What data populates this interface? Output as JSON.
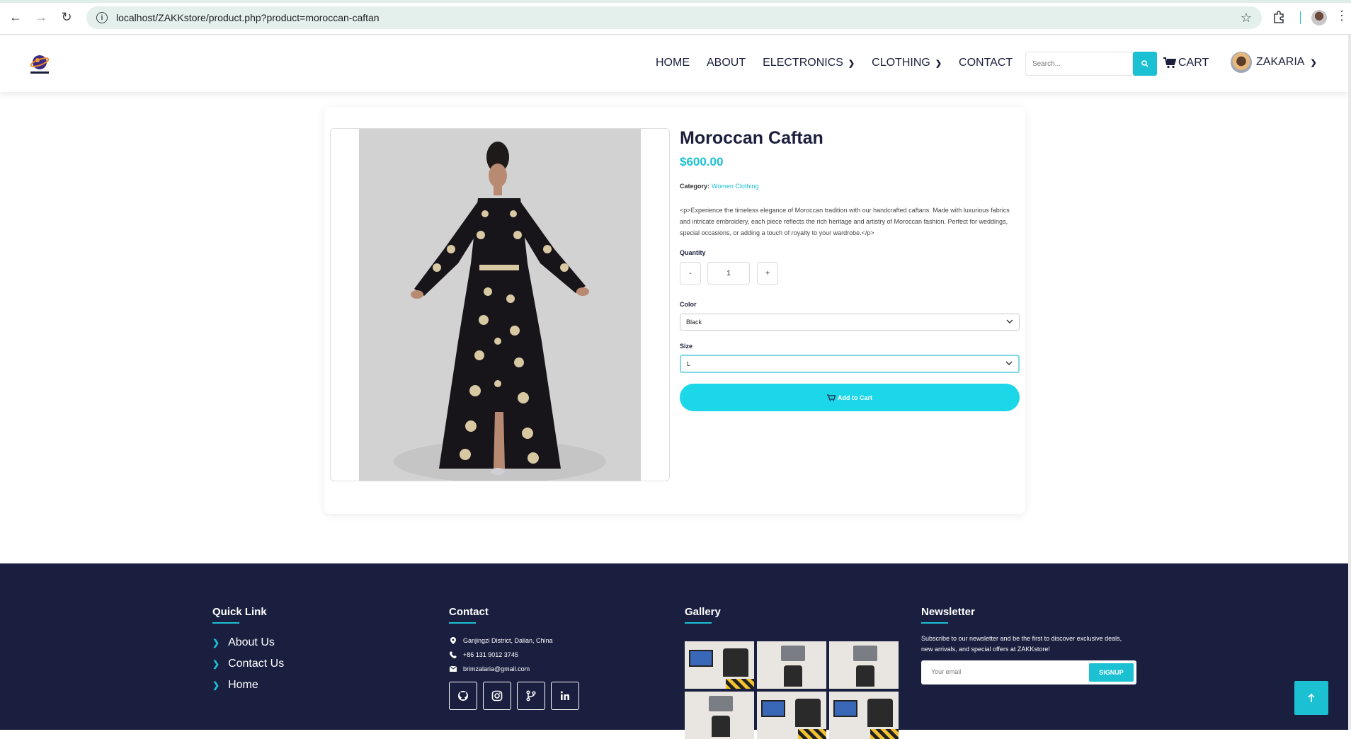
{
  "browser": {
    "url": "localhost/ZAKKstore/product.php?product=moroccan-caftan"
  },
  "header": {
    "nav": [
      {
        "label": "HOME",
        "has_dropdown": false
      },
      {
        "label": "ABOUT",
        "has_dropdown": false
      },
      {
        "label": "ELECTRONICS",
        "has_dropdown": true
      },
      {
        "label": "CLOTHING",
        "has_dropdown": true
      },
      {
        "label": "CONTACT",
        "has_dropdown": false
      }
    ],
    "search_placeholder": "Search...",
    "cart_label": "CART",
    "user_name": "ZAKARIA"
  },
  "product": {
    "title": "Moroccan Caftan",
    "price": "$600.00",
    "category_label": "Category:",
    "category_value": "Women Clothing",
    "description": "<p>Experience the timeless elegance of Moroccan tradition with our handcrafted caftans. Made with luxurious fabrics and intricate embroidery, each piece reflects the rich heritage and artistry of Moroccan fashion. Perfect for weddings, special occasions, or adding a touch of royalty to your wardrobe.</p>",
    "quantity_label": "Quantity",
    "quantity_minus": "-",
    "quantity_value": "1",
    "quantity_plus": "+",
    "color_label": "Color",
    "color_value": "Black",
    "size_label": "Size",
    "size_value": "L",
    "add_to_cart_label": "Add to Cart"
  },
  "footer": {
    "quick_link_heading": "Quick Link",
    "quick_links": [
      "About Us",
      "Contact Us",
      "Home"
    ],
    "contact_heading": "Contact",
    "address": "Ganjingzi District, Dalian, China",
    "phone": "+86 131 9012 3745",
    "email": "brimzalaria@gmail.com",
    "socials": [
      "github-icon",
      "instagram-icon",
      "git-branch-icon",
      "linkedin-icon"
    ],
    "gallery_heading": "Gallery",
    "newsletter_heading": "Newsletter",
    "newsletter_text": "Subscribe to our newsletter and be the first to discover exclusive deals, new arrivals, and special offers at ZAKKstore!",
    "newsletter_placeholder": "Your email",
    "signup_label": "SIGNUP"
  },
  "colors": {
    "accent": "#1bc0d3",
    "footer_bg": "#1a1f3f",
    "text_dark": "#1b1f3b"
  }
}
